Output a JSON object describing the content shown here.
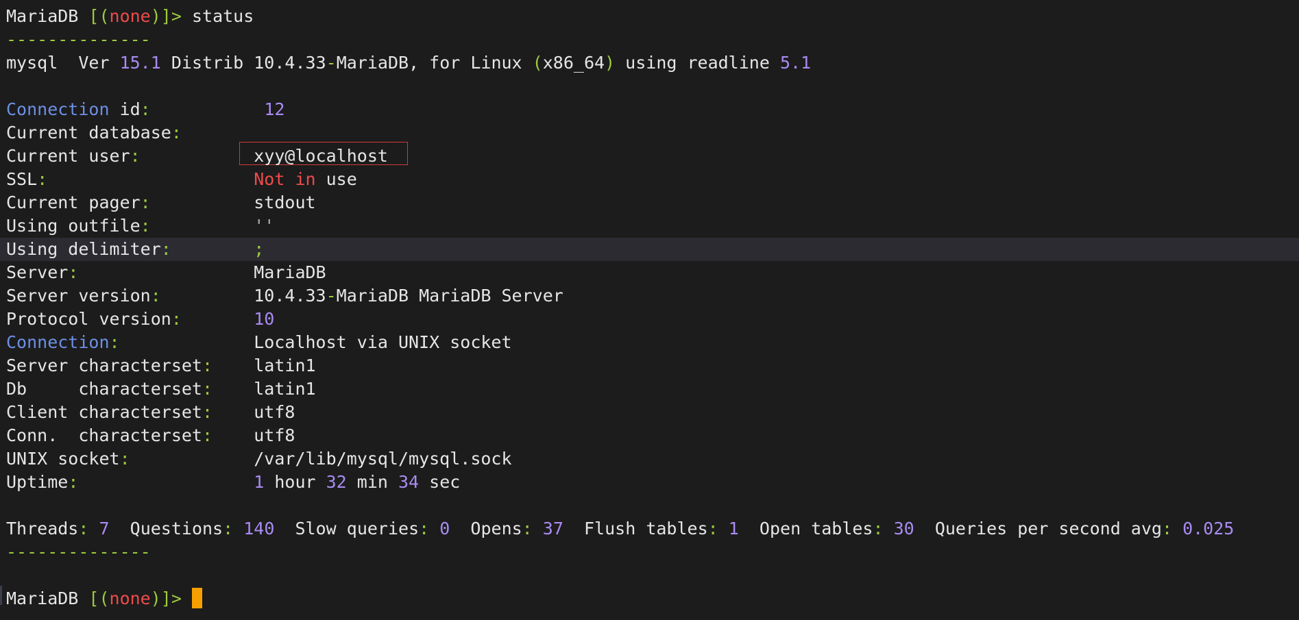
{
  "terminal": {
    "lines": [
      [
        {
          "t": "MariaDB ",
          "c": "default"
        },
        {
          "t": "[(",
          "c": "green"
        },
        {
          "t": "none",
          "c": "red"
        },
        {
          "t": ")]> ",
          "c": "green"
        },
        {
          "t": "status",
          "c": "default"
        }
      ],
      [
        {
          "t": "--------------",
          "c": "green"
        }
      ],
      [
        {
          "t": "mysql  Ver ",
          "c": "default"
        },
        {
          "t": "15.1",
          "c": "purple"
        },
        {
          "t": " Distrib 10.4.33",
          "c": "default"
        },
        {
          "t": "-",
          "c": "green"
        },
        {
          "t": "MariaDB, for Linux ",
          "c": "default"
        },
        {
          "t": "(",
          "c": "green"
        },
        {
          "t": "x86_64",
          "c": "default"
        },
        {
          "t": ")",
          "c": "green"
        },
        {
          "t": " using readline ",
          "c": "default"
        },
        {
          "t": "5.1",
          "c": "purple"
        }
      ],
      [],
      [
        {
          "t": "Connection",
          "c": "blue"
        },
        {
          "t": " id",
          "c": "default"
        },
        {
          "t": ":",
          "c": "green"
        },
        {
          "t": "           ",
          "c": "default"
        },
        {
          "t": "12",
          "c": "purple"
        }
      ],
      [
        {
          "t": "Current database",
          "c": "default"
        },
        {
          "t": ":",
          "c": "green"
        }
      ],
      [
        {
          "t": "Current user",
          "c": "default"
        },
        {
          "t": ":",
          "c": "green"
        },
        {
          "t": "           ",
          "c": "default"
        },
        {
          "t": "xyy@localhost",
          "c": "default"
        }
      ],
      [
        {
          "t": "SSL",
          "c": "default"
        },
        {
          "t": ":",
          "c": "green"
        },
        {
          "t": "                    ",
          "c": "default"
        },
        {
          "t": "Not in",
          "c": "red"
        },
        {
          "t": " use",
          "c": "default"
        }
      ],
      [
        {
          "t": "Current pager",
          "c": "default"
        },
        {
          "t": ":",
          "c": "green"
        },
        {
          "t": "          stdout",
          "c": "default"
        }
      ],
      [
        {
          "t": "Using outfile",
          "c": "default"
        },
        {
          "t": ":",
          "c": "green"
        },
        {
          "t": "          ",
          "c": "default"
        },
        {
          "t": "''",
          "c": "gray"
        }
      ],
      [
        {
          "t": "Using delimiter",
          "c": "default"
        },
        {
          "t": ":",
          "c": "green"
        },
        {
          "t": "        ",
          "c": "default"
        },
        {
          "t": ";",
          "c": "green"
        }
      ],
      [
        {
          "t": "Server",
          "c": "default"
        },
        {
          "t": ":",
          "c": "green"
        },
        {
          "t": "                 MariaDB",
          "c": "default"
        }
      ],
      [
        {
          "t": "Server version",
          "c": "default"
        },
        {
          "t": ":",
          "c": "green"
        },
        {
          "t": "         10.4.33",
          "c": "default"
        },
        {
          "t": "-",
          "c": "green"
        },
        {
          "t": "MariaDB MariaDB Server",
          "c": "default"
        }
      ],
      [
        {
          "t": "Protocol version",
          "c": "default"
        },
        {
          "t": ":",
          "c": "green"
        },
        {
          "t": "       ",
          "c": "default"
        },
        {
          "t": "10",
          "c": "purple"
        }
      ],
      [
        {
          "t": "Connection",
          "c": "blue"
        },
        {
          "t": ":",
          "c": "green"
        },
        {
          "t": "             Localhost via UNIX socket",
          "c": "default"
        }
      ],
      [
        {
          "t": "Server characterset",
          "c": "default"
        },
        {
          "t": ":",
          "c": "green"
        },
        {
          "t": "    latin1",
          "c": "default"
        }
      ],
      [
        {
          "t": "Db     characterset",
          "c": "default"
        },
        {
          "t": ":",
          "c": "green"
        },
        {
          "t": "    latin1",
          "c": "default"
        }
      ],
      [
        {
          "t": "Client characterset",
          "c": "default"
        },
        {
          "t": ":",
          "c": "green"
        },
        {
          "t": "    utf8",
          "c": "default"
        }
      ],
      [
        {
          "t": "Conn.  characterset",
          "c": "default"
        },
        {
          "t": ":",
          "c": "green"
        },
        {
          "t": "    utf8",
          "c": "default"
        }
      ],
      [
        {
          "t": "UNIX socket",
          "c": "default"
        },
        {
          "t": ":",
          "c": "green"
        },
        {
          "t": "            /var/lib/mysql/mysql.sock",
          "c": "default"
        }
      ],
      [
        {
          "t": "Uptime",
          "c": "default"
        },
        {
          "t": ":",
          "c": "green"
        },
        {
          "t": "                 ",
          "c": "default"
        },
        {
          "t": "1",
          "c": "purple"
        },
        {
          "t": " hour ",
          "c": "default"
        },
        {
          "t": "32",
          "c": "purple"
        },
        {
          "t": " min ",
          "c": "default"
        },
        {
          "t": "34",
          "c": "purple"
        },
        {
          "t": " sec",
          "c": "default"
        }
      ],
      [],
      [
        {
          "t": "Threads",
          "c": "default"
        },
        {
          "t": ":",
          "c": "green"
        },
        {
          "t": " ",
          "c": "default"
        },
        {
          "t": "7",
          "c": "purple"
        },
        {
          "t": "  Questions",
          "c": "default"
        },
        {
          "t": ":",
          "c": "green"
        },
        {
          "t": " ",
          "c": "default"
        },
        {
          "t": "140",
          "c": "purple"
        },
        {
          "t": "  Slow queries",
          "c": "default"
        },
        {
          "t": ":",
          "c": "green"
        },
        {
          "t": " ",
          "c": "default"
        },
        {
          "t": "0",
          "c": "purple"
        },
        {
          "t": "  Opens",
          "c": "default"
        },
        {
          "t": ":",
          "c": "green"
        },
        {
          "t": " ",
          "c": "default"
        },
        {
          "t": "37",
          "c": "purple"
        },
        {
          "t": "  Flush tables",
          "c": "default"
        },
        {
          "t": ":",
          "c": "green"
        },
        {
          "t": " ",
          "c": "default"
        },
        {
          "t": "1",
          "c": "purple"
        },
        {
          "t": "  Open tables",
          "c": "default"
        },
        {
          "t": ":",
          "c": "green"
        },
        {
          "t": " ",
          "c": "default"
        },
        {
          "t": "30",
          "c": "purple"
        },
        {
          "t": "  Queries per second avg",
          "c": "default"
        },
        {
          "t": ":",
          "c": "green"
        },
        {
          "t": " ",
          "c": "default"
        },
        {
          "t": "0.025",
          "c": "purple"
        }
      ],
      [
        {
          "t": "--------------",
          "c": "green"
        }
      ],
      [],
      [
        {
          "t": "MariaDB ",
          "c": "default"
        },
        {
          "t": "[(",
          "c": "green"
        },
        {
          "t": "none",
          "c": "red"
        },
        {
          "t": ")]> ",
          "c": "green"
        }
      ]
    ]
  }
}
